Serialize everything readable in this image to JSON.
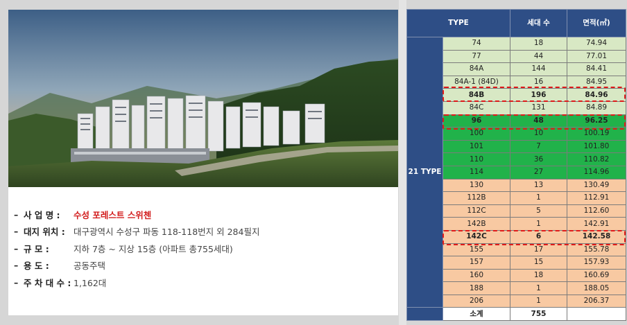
{
  "project": {
    "rows": [
      {
        "label": "사 업 명 :",
        "value": "수성 포레스트 스위첸",
        "highlight": true
      },
      {
        "label": "대지 위치 :",
        "value": "대구광역시 수성구 파동 118-118번지 외 284필지",
        "highlight": false
      },
      {
        "label": "규       모 :",
        "value": "지하 7층 ~ 지상 15층 (아파트 총755세대)",
        "highlight": false
      },
      {
        "label": "용       도 :",
        "value": "공동주택",
        "highlight": false
      },
      {
        "label": "주 차 대 수 :",
        "value": "1,162대",
        "highlight": false
      }
    ],
    "dash": "–"
  },
  "table": {
    "headers": [
      "TYPE",
      "세대 수",
      "면적(㎡)"
    ],
    "group_label": "21 TYPE",
    "rows": [
      {
        "type": "74",
        "units": "18",
        "area": "74.94",
        "color": "light"
      },
      {
        "type": "77",
        "units": "44",
        "area": "77.01",
        "color": "light"
      },
      {
        "type": "84A",
        "units": "144",
        "area": "84.41",
        "color": "light"
      },
      {
        "type": "84A-1 (84D)",
        "units": "16",
        "area": "84.95",
        "color": "light"
      },
      {
        "type": "84B",
        "units": "196",
        "area": "84.96",
        "color": "light",
        "bold": true
      },
      {
        "type": "84C",
        "units": "131",
        "area": "84.89",
        "color": "light"
      },
      {
        "type": "96",
        "units": "48",
        "area": "96.25",
        "color": "green",
        "bold": true
      },
      {
        "type": "100",
        "units": "10",
        "area": "100.19",
        "color": "green"
      },
      {
        "type": "101",
        "units": "7",
        "area": "101.80",
        "color": "green"
      },
      {
        "type": "110",
        "units": "36",
        "area": "110.82",
        "color": "green"
      },
      {
        "type": "114",
        "units": "27",
        "area": "114.96",
        "color": "green"
      },
      {
        "type": "130",
        "units": "13",
        "area": "130.49",
        "color": "peach"
      },
      {
        "type": "112B",
        "units": "1",
        "area": "112.91",
        "color": "peach"
      },
      {
        "type": "112C",
        "units": "5",
        "area": "112.60",
        "color": "peach"
      },
      {
        "type": "142B",
        "units": "1",
        "area": "142.91",
        "color": "peach"
      },
      {
        "type": "142C",
        "units": "6",
        "area": "142.58",
        "color": "peach",
        "bold": true
      },
      {
        "type": "155",
        "units": "17",
        "area": "155.78",
        "color": "peach"
      },
      {
        "type": "157",
        "units": "15",
        "area": "157.93",
        "color": "peach"
      },
      {
        "type": "160",
        "units": "18",
        "area": "160.69",
        "color": "peach"
      },
      {
        "type": "188",
        "units": "1",
        "area": "188.05",
        "color": "peach"
      },
      {
        "type": "206",
        "units": "1",
        "area": "206.37",
        "color": "peach"
      }
    ],
    "total": {
      "label": "소계",
      "units": "755",
      "area": ""
    }
  },
  "colors": {
    "header_bg": "#2e4e86",
    "light_green": "#d8e8c4",
    "green": "#21b24a",
    "peach": "#f8c9a2",
    "highlight_red": "#e01a1a",
    "project_name_red": "#d21d1d"
  }
}
